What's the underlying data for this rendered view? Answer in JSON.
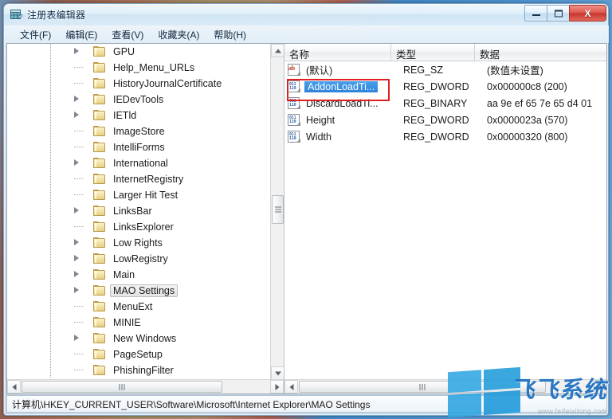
{
  "window": {
    "title": "注册表编辑器",
    "icon": "registry-editor-icon",
    "buttons": {
      "minimize": "最小化",
      "maximize": "最大化",
      "close": "X"
    }
  },
  "menubar": {
    "items": [
      {
        "label": "文件(F)",
        "name": "menu-file"
      },
      {
        "label": "编辑(E)",
        "name": "menu-edit"
      },
      {
        "label": "查看(V)",
        "name": "menu-view"
      },
      {
        "label": "收藏夹(A)",
        "name": "menu-favorites"
      },
      {
        "label": "帮助(H)",
        "name": "menu-help"
      }
    ]
  },
  "tree": {
    "nodes": [
      {
        "label": "GPU",
        "expandable": true,
        "selected": false
      },
      {
        "label": "Help_Menu_URLs",
        "expandable": false,
        "selected": false
      },
      {
        "label": "HistoryJournalCertificate",
        "expandable": false,
        "selected": false
      },
      {
        "label": "IEDevTools",
        "expandable": true,
        "selected": false
      },
      {
        "label": "IETld",
        "expandable": true,
        "selected": false
      },
      {
        "label": "ImageStore",
        "expandable": false,
        "selected": false
      },
      {
        "label": "IntelliForms",
        "expandable": false,
        "selected": false
      },
      {
        "label": "International",
        "expandable": true,
        "selected": false
      },
      {
        "label": "InternetRegistry",
        "expandable": false,
        "selected": false
      },
      {
        "label": "Larger Hit Test",
        "expandable": false,
        "selected": false
      },
      {
        "label": "LinksBar",
        "expandable": true,
        "selected": false
      },
      {
        "label": "LinksExplorer",
        "expandable": false,
        "selected": false
      },
      {
        "label": "Low Rights",
        "expandable": true,
        "selected": false
      },
      {
        "label": "LowRegistry",
        "expandable": true,
        "selected": false
      },
      {
        "label": "Main",
        "expandable": true,
        "selected": false
      },
      {
        "label": "MAO Settings",
        "expandable": true,
        "selected": true
      },
      {
        "label": "MenuExt",
        "expandable": false,
        "selected": false
      },
      {
        "label": "MINIE",
        "expandable": false,
        "selected": false
      },
      {
        "label": "New Windows",
        "expandable": true,
        "selected": false
      },
      {
        "label": "PageSetup",
        "expandable": false,
        "selected": false
      },
      {
        "label": "PhishingFilter",
        "expandable": false,
        "selected": false
      }
    ]
  },
  "list": {
    "columns": [
      {
        "label": "名称",
        "name": "column-name"
      },
      {
        "label": "类型",
        "name": "column-type"
      },
      {
        "label": "数据",
        "name": "column-data"
      }
    ],
    "rows": [
      {
        "name": "(默认)",
        "type": "REG_SZ",
        "data": "(数值未设置)",
        "icon": "string-value-icon",
        "selected": false
      },
      {
        "name": "AddonLoadTi...",
        "type": "REG_DWORD",
        "data": "0x000000c8 (200)",
        "icon": "binary-value-icon",
        "selected": true
      },
      {
        "name": "DiscardLoadTi...",
        "type": "REG_BINARY",
        "data": "aa 9e ef 65 7e 65 d4 01",
        "icon": "binary-value-icon",
        "selected": false
      },
      {
        "name": "Height",
        "type": "REG_DWORD",
        "data": "0x0000023a (570)",
        "icon": "binary-value-icon",
        "selected": false
      },
      {
        "name": "Width",
        "type": "REG_DWORD",
        "data": "0x00000320 (800)",
        "icon": "binary-value-icon",
        "selected": false
      }
    ]
  },
  "statusbar": {
    "path": "计算机\\HKEY_CURRENT_USER\\Software\\Microsoft\\Internet Explorer\\MAO Settings"
  },
  "watermark": {
    "text": "飞飞系统",
    "url": "www.feifeixitong.com"
  },
  "colors": {
    "annotation": "#e02020",
    "selection": "#2b7fd4",
    "accent": "#29a3e0"
  }
}
